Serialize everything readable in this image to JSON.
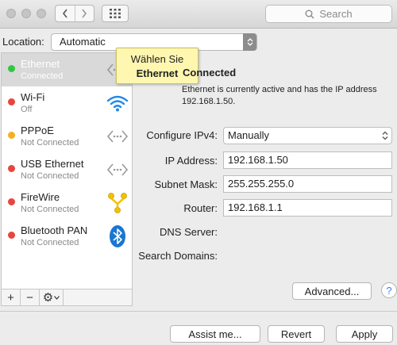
{
  "toolbar": {
    "search_placeholder": "Search",
    "icons": [
      "chevron-left-icon",
      "chevron-right-icon",
      "grid-icon",
      "search-icon"
    ]
  },
  "location": {
    "label": "Location:",
    "value": "Automatic"
  },
  "services": [
    {
      "name": "Ethernet",
      "status": "Connected",
      "dot_color": "#2ec840",
      "icon": "ethernet-arrows-icon",
      "selected": true
    },
    {
      "name": "Wi-Fi",
      "status": "Off",
      "dot_color": "#e8453c",
      "icon": "wifi-icon",
      "selected": false
    },
    {
      "name": "PPPoE",
      "status": "Not Connected",
      "dot_color": "#f4b120",
      "icon": "ethernet-arrows-icon",
      "selected": false
    },
    {
      "name": "USB Ethernet",
      "status": "Not Connected",
      "dot_color": "#e8453c",
      "icon": "ethernet-arrows-icon",
      "selected": false
    },
    {
      "name": "FireWire",
      "status": "Not Connected",
      "dot_color": "#e8453c",
      "icon": "firewire-icon",
      "selected": false
    },
    {
      "name": "Bluetooth PAN",
      "status": "Not Connected",
      "dot_color": "#e8453c",
      "icon": "bluetooth-icon",
      "selected": false
    }
  ],
  "sidebar_footer": {
    "add": "+",
    "remove": "−",
    "gear": "⚙"
  },
  "tooltip": {
    "line1": "Wählen Sie",
    "line2": "Ethernet"
  },
  "status": {
    "title": "Connected",
    "description": "Ethernet is currently active and has the IP address 192.168.1.50."
  },
  "form": {
    "configure_ipv4_label": "Configure IPv4:",
    "configure_ipv4_value": "Manually",
    "ip_label": "IP Address:",
    "ip_value": "192.168.1.50",
    "subnet_label": "Subnet Mask:",
    "subnet_value": "255.255.255.0",
    "router_label": "Router:",
    "router_value": "192.168.1.1",
    "dns_label": "DNS Server:",
    "search_domains_label": "Search Domains:"
  },
  "buttons": {
    "advanced": "Advanced...",
    "help": "?",
    "assist": "Assist me...",
    "revert": "Revert",
    "apply": "Apply"
  },
  "colors": {
    "selected_row": "#d9d9d9",
    "tooltip_bg": "#fff7b0",
    "wifi_blue": "#1e88e5",
    "bluetooth_blue": "#1976d2",
    "firewire_yellow": "#f2c200"
  }
}
